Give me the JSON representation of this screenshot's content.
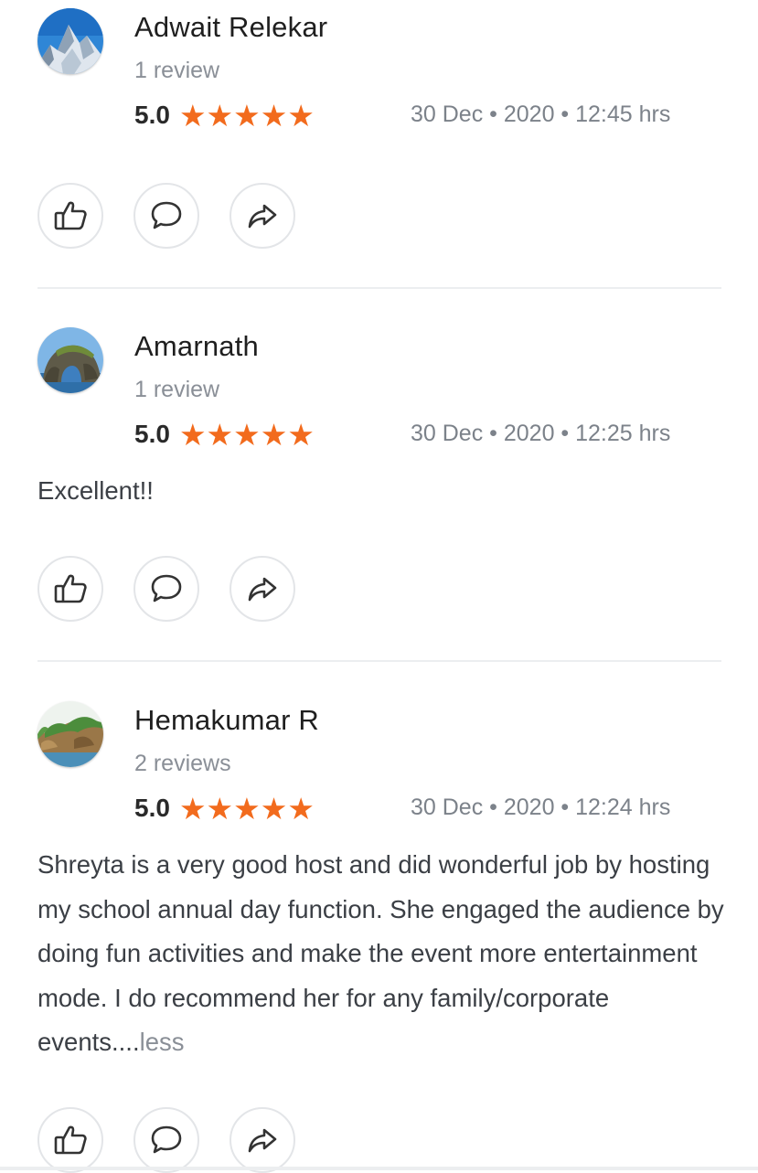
{
  "reviews": [
    {
      "name": "Adwait Relekar",
      "count": "1 review",
      "rating": "5.0",
      "stars": [
        "★",
        "★",
        "★",
        "★",
        "★"
      ],
      "date": "30 Dec • 2020 • 12:45 hrs",
      "text": "",
      "more": "",
      "avatar": "mountain-avatar"
    },
    {
      "name": "Amarnath",
      "count": "1 review",
      "rating": "5.0",
      "stars": [
        "★",
        "★",
        "★",
        "★",
        "★"
      ],
      "date": "30 Dec • 2020 • 12:25 hrs",
      "text": "Excellent!!",
      "more": "",
      "avatar": "rock-arch-avatar"
    },
    {
      "name": "Hemakumar R",
      "count": "2 reviews",
      "rating": "5.0",
      "stars": [
        "★",
        "★",
        "★",
        "★",
        "★"
      ],
      "date": "30 Dec • 2020 • 12:24 hrs",
      "text": "Shreyta is a very good host and did wonderful job by hosting my school annual day function. She engaged the audience by doing fun activities and make the event more entertainment mode. I do recommend her for any family/corporate events....",
      "more": "less",
      "avatar": "coast-rocks-avatar"
    }
  ],
  "icons": {
    "like": "thumbs-up-icon",
    "comment": "comment-icon",
    "share": "share-icon"
  },
  "colors": {
    "star": "#f26b1d",
    "muted": "#8a8f97",
    "divider": "#eceef0"
  }
}
